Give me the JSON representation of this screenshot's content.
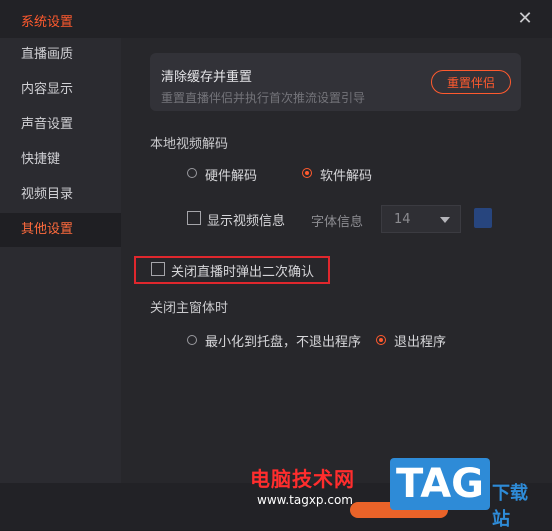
{
  "window": {
    "title": "系统设置",
    "close_glyph": "✕"
  },
  "sidebar": {
    "items": [
      {
        "label": "直播画质",
        "active": false
      },
      {
        "label": "内容显示",
        "active": false
      },
      {
        "label": "声音设置",
        "active": false
      },
      {
        "label": "快捷键",
        "active": false
      },
      {
        "label": "视频目录",
        "active": false
      },
      {
        "label": "其他设置",
        "active": true
      }
    ]
  },
  "reset_card": {
    "title": "清除缓存并重置",
    "description": "重置直播伴侣并执行首次推流设置引导",
    "button_label": "重置伴侣"
  },
  "decode": {
    "label": "本地视频解码",
    "options": [
      "硬件解码",
      "软件解码"
    ],
    "selected": "软件解码"
  },
  "video_info": {
    "checkbox_label": "显示视频信息",
    "checked": false,
    "font_label": "字体信息",
    "font_size": "14",
    "color": "#27457e"
  },
  "confirm_close": {
    "label": "关闭直播时弹出二次确认",
    "checked": false
  },
  "main_window_close": {
    "label": "关闭主窗体时",
    "options": [
      "最小化到托盘，不退出程序",
      "退出程序"
    ],
    "selected": "退出程序"
  },
  "watermark": {
    "site_name": "电脑技术网",
    "url": "www.tagxp.com",
    "logo_text": "TAG",
    "suffix": "下载站"
  },
  "colors": {
    "accent": "#ff5a2e",
    "highlight_box": "#e0272d"
  }
}
